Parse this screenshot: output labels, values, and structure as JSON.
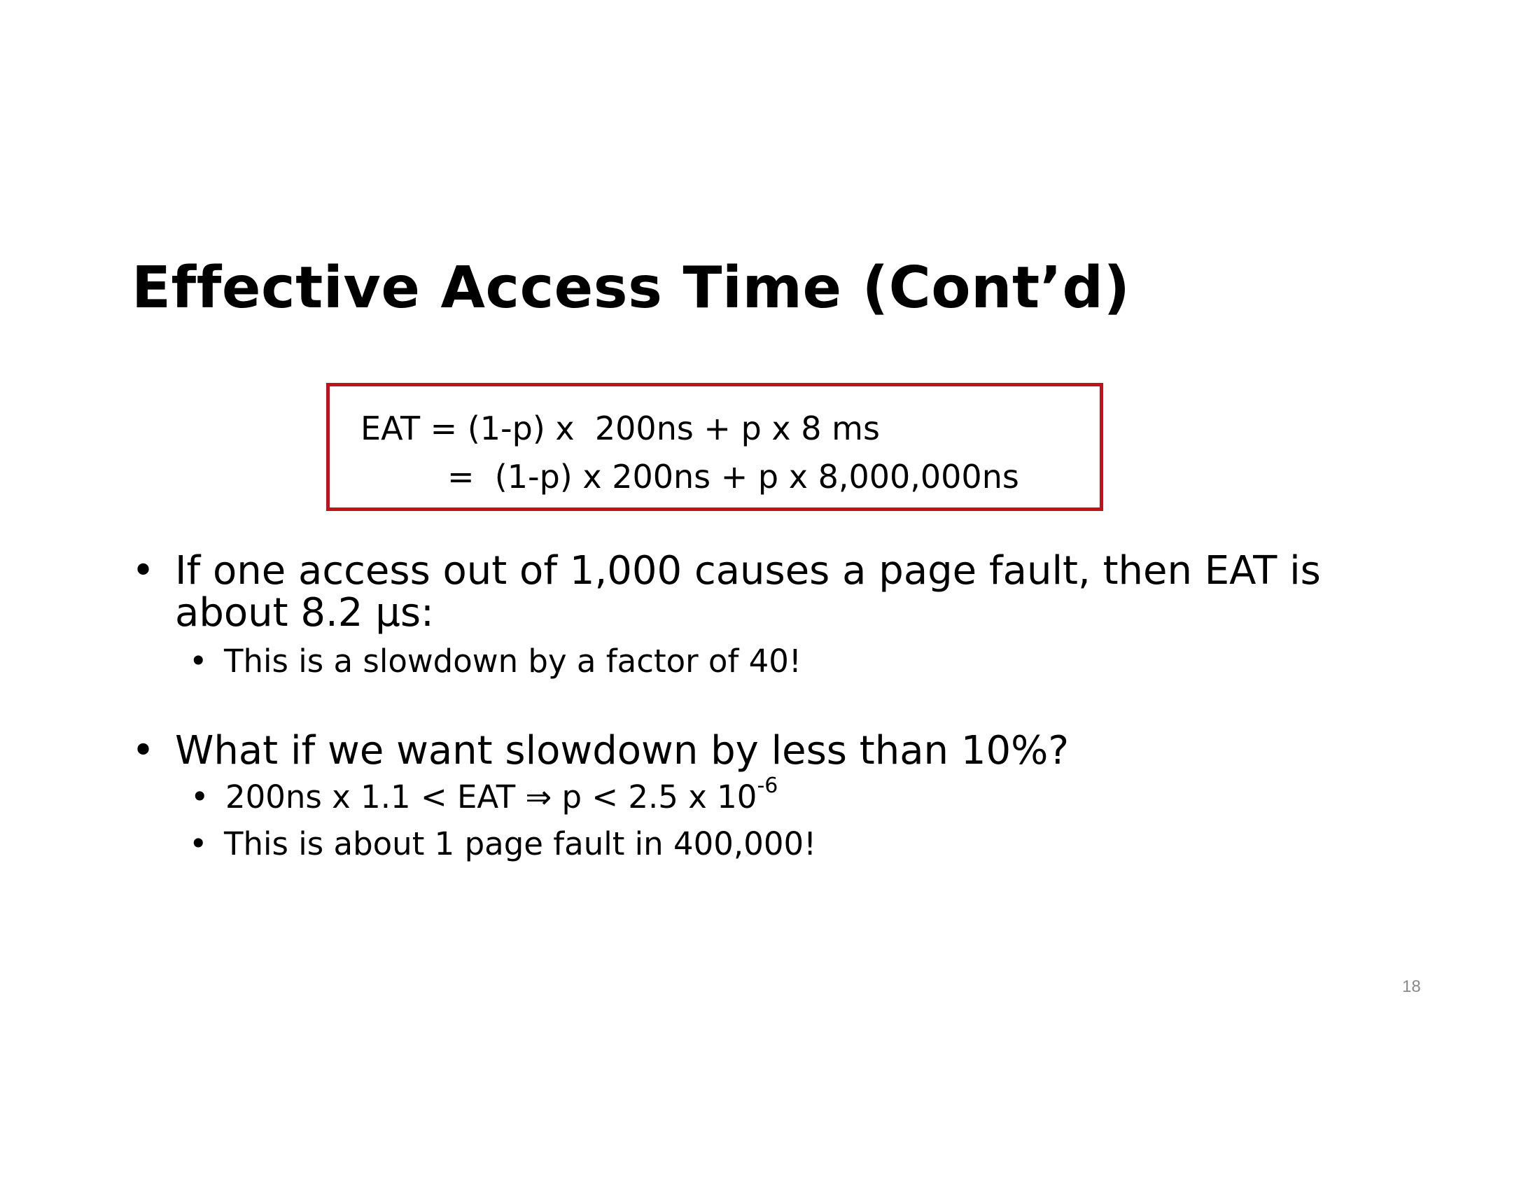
{
  "slide": {
    "title": "Effective Access Time (Cont’d)",
    "page_number": "18"
  },
  "formula_box": {
    "border_color": "#c0121a",
    "line1": "EAT = (1-p) x  200ns + p x 8 ms",
    "line2": "=  (1-p) x 200ns + p x 8,000,000ns"
  },
  "bullets": [
    {
      "text": "If one access out of 1,000 causes a page fault, then EAT is",
      "continuation": "about 8.2 μs:",
      "sub": [
        "This is a slowdown by a factor of 40!"
      ]
    },
    {
      "text": "What if we want slowdown by less than 10%?",
      "sub": [
        "200ns x 1.1 < EAT ⇒ p < 2.5 x 10",
        "This is about 1 page fault in 400,000!"
      ],
      "sub1_superscript": "-6"
    }
  ],
  "bullet_glyph": "•"
}
